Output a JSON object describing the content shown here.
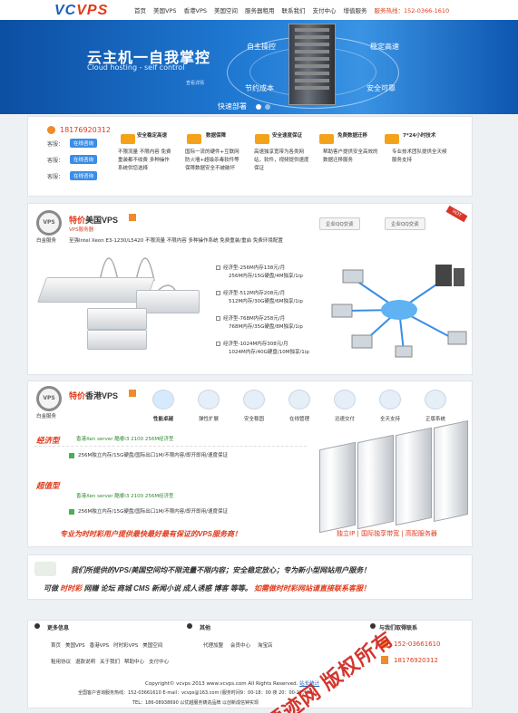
{
  "header": {
    "logo_vc": "VC",
    "logo_vps": "VPS",
    "nav": [
      "首页",
      "美国VPS",
      "香港VPS",
      "美国空间",
      "服务器租用",
      "联系我们",
      "支付中心",
      "增值服务"
    ],
    "hotline": "服务热线：152-0366-1610"
  },
  "banner": {
    "title": "云主机一自我掌控",
    "subtitle": "Cloud hosting - self control",
    "more": "查看详情",
    "labels": [
      "自主操控",
      "稳定高速",
      "节约成本",
      "安全可靠",
      "快速部署"
    ]
  },
  "contact": {
    "phone": "18176920312",
    "qq_label": "客服：",
    "qq_button": "在线咨询"
  },
  "features": [
    {
      "title": "安全稳定高速",
      "desc": "不限流量 不限内容 免费重装都不收费 多种操作系统供您选择"
    },
    {
      "title": "数据保障",
      "desc": "国际一流的硬件+互联网防火墙+超级杀毒软件等保障数据安全不被破坏"
    },
    {
      "title": "安全速度保证",
      "desc": "高速独享宽带为各类网站，软件，视频提供速度保证"
    },
    {
      "title": "免费数据迁移",
      "desc": "帮助客户提供安全高效的数据迁移服务"
    },
    {
      "title": "7*24小时技术",
      "desc": "专业技术团队提供全天候服务支持"
    }
  ],
  "us_vps": {
    "badge": "VPS",
    "title_a": "特价",
    "title_b": "美国VPS",
    "badge_sub": "白金服务",
    "sub": "VPS服务器",
    "desc": "至强Intel Xeon E3-1230/L5420 不限流量 不限内容 多种操作系统 免费重装/重启 免费环境配置",
    "qq": [
      "企业QQ交谈",
      "企业QQ交谈"
    ],
    "hot": "HOT",
    "plans": [
      {
        "a": "经济型-256M内存138元/月",
        "b": "256M内存/15G硬盘/4M独享/1ip"
      },
      {
        "a": "经济型-512M内存208元/月",
        "b": "512M内存/30G硬盘/6M独享/1ip"
      },
      {
        "a": "经济型-768M内存258元/月",
        "b": "768M内存/35G硬盘/8M独享/1ip"
      },
      {
        "a": "经济型-1024M内存308元/月",
        "b": "1024M内存/40G硬盘/10M独享/1ip"
      }
    ]
  },
  "hk_vps": {
    "badge": "VPS",
    "title_a": "特价",
    "title_b": "香港VPS",
    "badge_sub": "白金服务",
    "tabs": [
      "性能卓越",
      "弹性扩展",
      "安全稳固",
      "在线管理",
      "迅速交付",
      "全天支持",
      "正版系统"
    ],
    "types": [
      {
        "name": "经济型",
        "line1": "香港Xen server 酷睿i3 2100 256M经济型",
        "line2": "256M独立内存/15G硬盘/国际出口1M/不限内容/即开即用/速度保证"
      },
      {
        "name": "超值型",
        "line1": "香港Xen server 酷睿i3 2100 256M经济型",
        "line2": "256M独立内存/15G硬盘/国际出口1M/不限内容/即开即用/速度保证"
      }
    ],
    "slogan": "专业为时时彩用户提供最快最好最有保证的VPS服务商！",
    "right": "独立IP | 国际独享带宽 | 高配服务器"
  },
  "promo": {
    "line1": "我们所提供的VPS/美国空间均不限流量不限内容；安全稳定放心；专为新小型网站用户服务！",
    "line2a": "可做",
    "line2b": "时时彩",
    "line2c": "网赚 论坛 商城 CMS 新闻小说 成人诱惑 博客 等等。",
    "line2d": "如需做时时彩网站请直接联系客服！"
  },
  "footer": {
    "more": "更多信息",
    "other": "其他",
    "contact": "与我们取得联系",
    "links1": [
      "首页",
      "美国VPS",
      "香港VPS",
      "时时彩VPS",
      "美国空间"
    ],
    "links2": [
      "租用协议",
      "退款说明",
      "关于我们",
      "帮助中心",
      "支付中心"
    ],
    "other_links": [
      "代理加盟",
      "会员中心",
      "淘宝店"
    ],
    "phone1": "152-03661610",
    "phone2": "18176920312",
    "copyright": "Copyright© vcvps 2013 www.vcvps.com All Rights Reserved.",
    "stats": "站长统计",
    "info1": "全国客户咨询服务热线：152-03661610 E-mail：vcvps@163.com (服务时间9：00-18：00 夜 20：00-22：00)",
    "info2": "TEL：186-08938690 以优越服务铸造品牌 以创新成信钟实现"
  },
  "watermark": "源迹网 版权所有"
}
